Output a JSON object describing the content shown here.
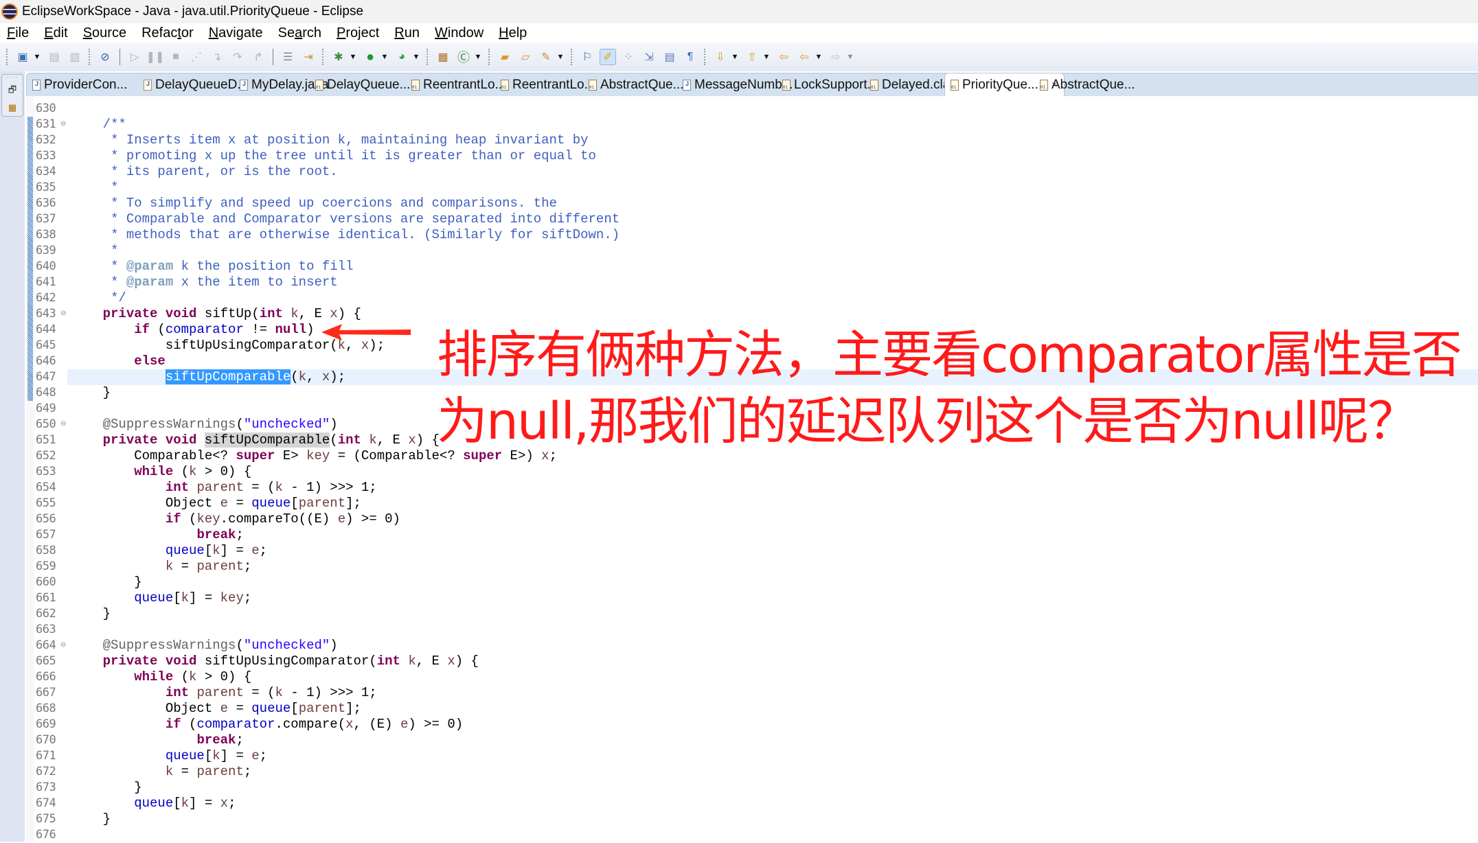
{
  "window": {
    "title": "EclipseWorkSpace - Java - java.util.PriorityQueue - Eclipse"
  },
  "menu": [
    {
      "label": "File",
      "mnemonic": "F",
      "rest": "ile"
    },
    {
      "label": "Edit",
      "mnemonic": "E",
      "rest": "dit"
    },
    {
      "label": "Source",
      "mnemonic": "S",
      "rest": "ource"
    },
    {
      "label": "Refactor",
      "pre": "Refac",
      "mnemonic": "t",
      "rest": "or"
    },
    {
      "label": "Navigate",
      "mnemonic": "N",
      "rest": "avigate"
    },
    {
      "label": "Search",
      "pre": "Se",
      "mnemonic": "a",
      "rest": "rch"
    },
    {
      "label": "Project",
      "mnemonic": "P",
      "rest": "roject"
    },
    {
      "label": "Run",
      "mnemonic": "R",
      "rest": "un"
    },
    {
      "label": "Window",
      "mnemonic": "W",
      "rest": "indow"
    },
    {
      "label": "Help",
      "mnemonic": "H",
      "rest": "elp"
    }
  ],
  "toolbar": {
    "icons": {
      "new": "new-wizard-icon",
      "save": "save-icon",
      "save_all": "save-all-icon",
      "skip_breakpoints": "skip-breakpoints-icon",
      "resume": "resume-icon",
      "suspend": "suspend-icon",
      "terminate": "terminate-icon",
      "disconnect": "disconnect-icon",
      "step_into": "step-into-icon",
      "step_over": "step-over-icon",
      "step_return": "step-return-icon",
      "drop_to_frame": "drop-to-frame-icon",
      "use_step_filters": "use-step-filters-icon",
      "debug": "debug-icon",
      "run": "run-icon",
      "external_tools": "external-tools-icon",
      "new_java_package": "new-java-package-icon",
      "new_java_class": "new-java-class-icon",
      "open_type": "open-type-icon",
      "open_task": "open-task-icon",
      "search": "search-icon",
      "toggle_breadcrumb": "toggle-breadcrumb-icon",
      "mark_occurrences": "mark-occurrences-icon",
      "toggle_block_selection": "toggle-block-selection-icon",
      "word_wrap": "word-wrap-icon",
      "show_source_selected": "show-source-of-selected-element-icon",
      "show_whitespace": "show-whitespace-icon",
      "next_annotation": "next-annotation-icon",
      "previous_annotation": "previous-annotation-icon",
      "last_edit_location": "last-edit-location-icon",
      "back": "back-icon",
      "forward": "forward-icon"
    }
  },
  "tabs": [
    {
      "label": "ProviderCon...",
      "type": "java"
    },
    {
      "label": "DelayQueueD...",
      "type": "java-warning"
    },
    {
      "label": "MyDelay.java",
      "type": "java"
    },
    {
      "label": "DelayQueue....",
      "type": "class"
    },
    {
      "label": "ReentrantLo...",
      "type": "class"
    },
    {
      "label": "ReentrantLo...",
      "type": "class"
    },
    {
      "label": "AbstractQue...",
      "type": "class"
    },
    {
      "label": "MessageNumb...",
      "type": "java"
    },
    {
      "label": "LockSupport...",
      "type": "class"
    },
    {
      "label": "Delayed.class",
      "type": "class"
    },
    {
      "label": "PriorityQue...",
      "type": "class",
      "active": true,
      "close": "✕"
    },
    {
      "label": "AbstractQue...",
      "type": "class"
    }
  ],
  "editor": {
    "first_line": 630,
    "current_line": 647,
    "lines": [
      {
        "n": "630",
        "segs": []
      },
      {
        "n": "631",
        "fold": true,
        "segs": [
          [
            "doc",
            "    /**"
          ]
        ]
      },
      {
        "n": "632",
        "segs": [
          [
            "doc",
            "     * Inserts item x at position k, maintaining heap invariant by"
          ]
        ]
      },
      {
        "n": "633",
        "segs": [
          [
            "doc",
            "     * promoting x up the tree until it is greater than or equal to"
          ]
        ]
      },
      {
        "n": "634",
        "segs": [
          [
            "doc",
            "     * its parent, or is the root."
          ]
        ]
      },
      {
        "n": "635",
        "segs": [
          [
            "doc",
            "     *"
          ]
        ]
      },
      {
        "n": "636",
        "segs": [
          [
            "doc",
            "     * To simplify and speed up coercions and comparisons. the"
          ]
        ]
      },
      {
        "n": "637",
        "segs": [
          [
            "doc",
            "     * Comparable and Comparator versions are separated into different"
          ]
        ]
      },
      {
        "n": "638",
        "segs": [
          [
            "doc",
            "     * methods that are otherwise identical. (Similarly for siftDown.)"
          ]
        ]
      },
      {
        "n": "639",
        "segs": [
          [
            "doc",
            "     *"
          ]
        ]
      },
      {
        "n": "640",
        "segs": [
          [
            "doc",
            "     * "
          ],
          [
            "tag",
            "@param"
          ],
          [
            "doc",
            " k the position to fill"
          ]
        ]
      },
      {
        "n": "641",
        "segs": [
          [
            "doc",
            "     * "
          ],
          [
            "tag",
            "@param"
          ],
          [
            "doc",
            " x the item to insert"
          ]
        ]
      },
      {
        "n": "642",
        "segs": [
          [
            "doc",
            "     */"
          ]
        ]
      },
      {
        "n": "643",
        "fold": true,
        "segs": [
          [
            "",
            "    "
          ],
          [
            "kw",
            "private"
          ],
          [
            "",
            " "
          ],
          [
            "kw",
            "void"
          ],
          [
            "",
            " siftUp("
          ],
          [
            "kw",
            "int"
          ],
          [
            "",
            " "
          ],
          [
            "var",
            "k"
          ],
          [
            "",
            ", E "
          ],
          [
            "var",
            "x"
          ],
          [
            "",
            ") {"
          ]
        ]
      },
      {
        "n": "644",
        "segs": [
          [
            "",
            "        "
          ],
          [
            "kw",
            "if"
          ],
          [
            "",
            " ("
          ],
          [
            "field",
            "comparator"
          ],
          [
            "",
            " != "
          ],
          [
            "kw",
            "null"
          ],
          [
            "",
            ")"
          ]
        ]
      },
      {
        "n": "645",
        "segs": [
          [
            "",
            "            siftUpUsingComparator("
          ],
          [
            "var",
            "k"
          ],
          [
            "",
            ", "
          ],
          [
            "var",
            "x"
          ],
          [
            "",
            ");"
          ]
        ]
      },
      {
        "n": "646",
        "segs": [
          [
            "",
            "        "
          ],
          [
            "kw",
            "else"
          ]
        ]
      },
      {
        "n": "647",
        "segs": [
          [
            "",
            "            "
          ],
          [
            "sel",
            "siftUpComparable"
          ],
          [
            "",
            "("
          ],
          [
            "var",
            "k"
          ],
          [
            "",
            ", "
          ],
          [
            "var",
            "x"
          ],
          [
            "",
            ");"
          ]
        ]
      },
      {
        "n": "648",
        "segs": [
          [
            "",
            "    }"
          ]
        ]
      },
      {
        "n": "649",
        "segs": []
      },
      {
        "n": "650",
        "fold": true,
        "segs": [
          [
            "ann",
            "    @SuppressWarnings"
          ],
          [
            "",
            "("
          ],
          [
            "str",
            "\"unchecked\""
          ],
          [
            "",
            ")"
          ]
        ]
      },
      {
        "n": "651",
        "segs": [
          [
            "",
            "    "
          ],
          [
            "kw",
            "private"
          ],
          [
            "",
            " "
          ],
          [
            "kw",
            "void"
          ],
          [
            "",
            " "
          ],
          [
            "occ",
            "siftUpComparable"
          ],
          [
            "",
            "("
          ],
          [
            "kw",
            "int"
          ],
          [
            "",
            " "
          ],
          [
            "var",
            "k"
          ],
          [
            "",
            ", E "
          ],
          [
            "var",
            "x"
          ],
          [
            "",
            ") {"
          ]
        ]
      },
      {
        "n": "652",
        "segs": [
          [
            "",
            "        Comparable<? "
          ],
          [
            "kw",
            "super"
          ],
          [
            "",
            " E> "
          ],
          [
            "var",
            "key"
          ],
          [
            "",
            " = (Comparable<? "
          ],
          [
            "kw",
            "super"
          ],
          [
            "",
            " E>) "
          ],
          [
            "var",
            "x"
          ],
          [
            "",
            ";"
          ]
        ]
      },
      {
        "n": "653",
        "segs": [
          [
            "",
            "        "
          ],
          [
            "kw",
            "while"
          ],
          [
            "",
            " ("
          ],
          [
            "var",
            "k"
          ],
          [
            "",
            " > 0) {"
          ]
        ]
      },
      {
        "n": "654",
        "segs": [
          [
            "",
            "            "
          ],
          [
            "kw",
            "int"
          ],
          [
            "",
            " "
          ],
          [
            "var",
            "parent"
          ],
          [
            "",
            " = ("
          ],
          [
            "var",
            "k"
          ],
          [
            "",
            " - 1) >>> 1;"
          ]
        ]
      },
      {
        "n": "655",
        "segs": [
          [
            "",
            "            Object "
          ],
          [
            "var",
            "e"
          ],
          [
            "",
            " = "
          ],
          [
            "field",
            "queue"
          ],
          [
            "",
            "["
          ],
          [
            "var",
            "parent"
          ],
          [
            "",
            "];"
          ]
        ]
      },
      {
        "n": "656",
        "segs": [
          [
            "",
            "            "
          ],
          [
            "kw",
            "if"
          ],
          [
            "",
            " ("
          ],
          [
            "var",
            "key"
          ],
          [
            "",
            ".compareTo((E) "
          ],
          [
            "var",
            "e"
          ],
          [
            "",
            ") >= 0)"
          ]
        ]
      },
      {
        "n": "657",
        "segs": [
          [
            "",
            "                "
          ],
          [
            "kw",
            "break"
          ],
          [
            "",
            ";"
          ]
        ]
      },
      {
        "n": "658",
        "segs": [
          [
            "",
            "            "
          ],
          [
            "field",
            "queue"
          ],
          [
            "",
            "["
          ],
          [
            "var",
            "k"
          ],
          [
            "",
            "] = "
          ],
          [
            "var",
            "e"
          ],
          [
            "",
            ";"
          ]
        ]
      },
      {
        "n": "659",
        "segs": [
          [
            "",
            "            "
          ],
          [
            "var",
            "k"
          ],
          [
            "",
            " = "
          ],
          [
            "var",
            "parent"
          ],
          [
            "",
            ";"
          ]
        ]
      },
      {
        "n": "660",
        "segs": [
          [
            "",
            "        }"
          ]
        ]
      },
      {
        "n": "661",
        "segs": [
          [
            "",
            "        "
          ],
          [
            "field",
            "queue"
          ],
          [
            "",
            "["
          ],
          [
            "var",
            "k"
          ],
          [
            "",
            "] = "
          ],
          [
            "var",
            "key"
          ],
          [
            "",
            ";"
          ]
        ]
      },
      {
        "n": "662",
        "segs": [
          [
            "",
            "    }"
          ]
        ]
      },
      {
        "n": "663",
        "segs": []
      },
      {
        "n": "664",
        "fold": true,
        "segs": [
          [
            "ann",
            "    @SuppressWarnings"
          ],
          [
            "",
            "("
          ],
          [
            "str",
            "\"unchecked\""
          ],
          [
            "",
            ")"
          ]
        ]
      },
      {
        "n": "665",
        "segs": [
          [
            "",
            "    "
          ],
          [
            "kw",
            "private"
          ],
          [
            "",
            " "
          ],
          [
            "kw",
            "void"
          ],
          [
            "",
            " siftUpUsingComparator("
          ],
          [
            "kw",
            "int"
          ],
          [
            "",
            " "
          ],
          [
            "var",
            "k"
          ],
          [
            "",
            ", E "
          ],
          [
            "var",
            "x"
          ],
          [
            "",
            ") {"
          ]
        ]
      },
      {
        "n": "666",
        "segs": [
          [
            "",
            "        "
          ],
          [
            "kw",
            "while"
          ],
          [
            "",
            " ("
          ],
          [
            "var",
            "k"
          ],
          [
            "",
            " > 0) {"
          ]
        ]
      },
      {
        "n": "667",
        "segs": [
          [
            "",
            "            "
          ],
          [
            "kw",
            "int"
          ],
          [
            "",
            " "
          ],
          [
            "var",
            "parent"
          ],
          [
            "",
            " = ("
          ],
          [
            "var",
            "k"
          ],
          [
            "",
            " - 1) >>> 1;"
          ]
        ]
      },
      {
        "n": "668",
        "segs": [
          [
            "",
            "            Object "
          ],
          [
            "var",
            "e"
          ],
          [
            "",
            " = "
          ],
          [
            "field",
            "queue"
          ],
          [
            "",
            "["
          ],
          [
            "var",
            "parent"
          ],
          [
            "",
            "];"
          ]
        ]
      },
      {
        "n": "669",
        "segs": [
          [
            "",
            "            "
          ],
          [
            "kw",
            "if"
          ],
          [
            "",
            " ("
          ],
          [
            "field",
            "comparator"
          ],
          [
            "",
            ".compare("
          ],
          [
            "var",
            "x"
          ],
          [
            "",
            ", (E) "
          ],
          [
            "var",
            "e"
          ],
          [
            "",
            ") >= 0)"
          ]
        ]
      },
      {
        "n": "670",
        "segs": [
          [
            "",
            "                "
          ],
          [
            "kw",
            "break"
          ],
          [
            "",
            ";"
          ]
        ]
      },
      {
        "n": "671",
        "segs": [
          [
            "",
            "            "
          ],
          [
            "field",
            "queue"
          ],
          [
            "",
            "["
          ],
          [
            "var",
            "k"
          ],
          [
            "",
            "] = "
          ],
          [
            "var",
            "e"
          ],
          [
            "",
            ";"
          ]
        ]
      },
      {
        "n": "672",
        "segs": [
          [
            "",
            "            "
          ],
          [
            "var",
            "k"
          ],
          [
            "",
            " = "
          ],
          [
            "var",
            "parent"
          ],
          [
            "",
            ";"
          ]
        ]
      },
      {
        "n": "673",
        "segs": [
          [
            "",
            "        }"
          ]
        ]
      },
      {
        "n": "674",
        "segs": [
          [
            "",
            "        "
          ],
          [
            "field",
            "queue"
          ],
          [
            "",
            "["
          ],
          [
            "var",
            "k"
          ],
          [
            "",
            "] = "
          ],
          [
            "var",
            "x"
          ],
          [
            "",
            ";"
          ]
        ]
      },
      {
        "n": "675",
        "segs": [
          [
            "",
            "    }"
          ]
        ]
      },
      {
        "n": "676",
        "segs": []
      }
    ]
  },
  "annotation": {
    "line1": "排序有俩种方法，主要看comparator属性是否",
    "line2": "为null,那我们的延迟队列这个是否为null呢？",
    "color": "#ff1a1a"
  },
  "colors": {
    "keyword": "#7f0055",
    "javadoc": "#3f5fbf",
    "field": "#0000c0",
    "string": "#2a00ff",
    "selection": "#3399ff",
    "current_line": "#e8f2fe",
    "tabstrip": "#d3e1f0"
  }
}
